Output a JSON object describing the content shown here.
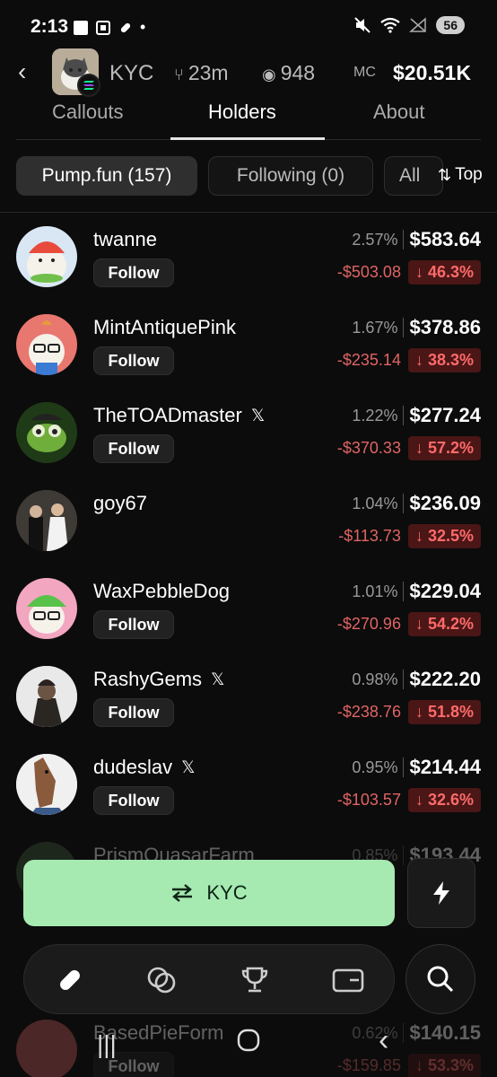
{
  "status": {
    "time": "2:13",
    "battery": "56"
  },
  "token": {
    "name": "KYC",
    "age": "23m",
    "views": "948",
    "mc_label": "MC",
    "mc_value": "$20.51K"
  },
  "tabs": [
    {
      "label": "Callouts"
    },
    {
      "label": "Holders",
      "active": true
    },
    {
      "label": "About"
    }
  ],
  "chips": [
    {
      "label": "Pump.fun (157)",
      "active": true
    },
    {
      "label": "Following (0)"
    },
    {
      "label": "All"
    }
  ],
  "sort": {
    "label": "Top"
  },
  "holders": [
    {
      "name": "twanne",
      "x": false,
      "follow": "Follow",
      "pct": "2.57%",
      "value": "$583.64",
      "pnl": "-$503.08",
      "pnl_pct": "↓ 46.3%",
      "avatar_color": "#d9e7f5"
    },
    {
      "name": "MintAntiquePink",
      "x": false,
      "follow": "Follow",
      "pct": "1.67%",
      "value": "$378.86",
      "pnl": "-$235.14",
      "pnl_pct": "↓ 38.3%",
      "avatar_color": "#e8776f"
    },
    {
      "name": "TheTOADmaster",
      "x": true,
      "follow": "Follow",
      "pct": "1.22%",
      "value": "$277.24",
      "pnl": "-$370.33",
      "pnl_pct": "↓ 57.2%",
      "avatar_color": "#1f3a17"
    },
    {
      "name": "goy67",
      "x": false,
      "follow": "",
      "pct": "1.04%",
      "value": "$236.09",
      "pnl": "-$113.73",
      "pnl_pct": "↓ 32.5%",
      "avatar_color": "#4a4a4a"
    },
    {
      "name": "WaxPebbleDog",
      "x": false,
      "follow": "Follow",
      "pct": "1.01%",
      "value": "$229.04",
      "pnl": "-$270.96",
      "pnl_pct": "↓ 54.2%",
      "avatar_color": "#f2a6c0"
    },
    {
      "name": "RashyGems",
      "x": true,
      "follow": "Follow",
      "pct": "0.98%",
      "value": "$222.20",
      "pnl": "-$238.76",
      "pnl_pct": "↓ 51.8%",
      "avatar_color": "#e9e9e9"
    },
    {
      "name": "dudeslav",
      "x": true,
      "follow": "Follow",
      "pct": "0.95%",
      "value": "$214.44",
      "pnl": "-$103.57",
      "pnl_pct": "↓ 32.6%",
      "avatar_color": "#e9e9e9"
    }
  ],
  "partial_rows": [
    {
      "name": "PrismQuasarFarm",
      "pct": "0.85%",
      "value": "$193.44"
    },
    {
      "name": "BasedPieForm",
      "pct": "0.62%",
      "value": "$140.15",
      "pnl": "-$159.85",
      "pnl_pct": "↓ 53.3%",
      "follow": "Follow"
    }
  ],
  "actions": {
    "buy_label": "KYC"
  },
  "colors": {
    "accent_green": "#a6eab2",
    "loss_red": "#e06464",
    "loss_badge_bg": "#4a1616"
  }
}
